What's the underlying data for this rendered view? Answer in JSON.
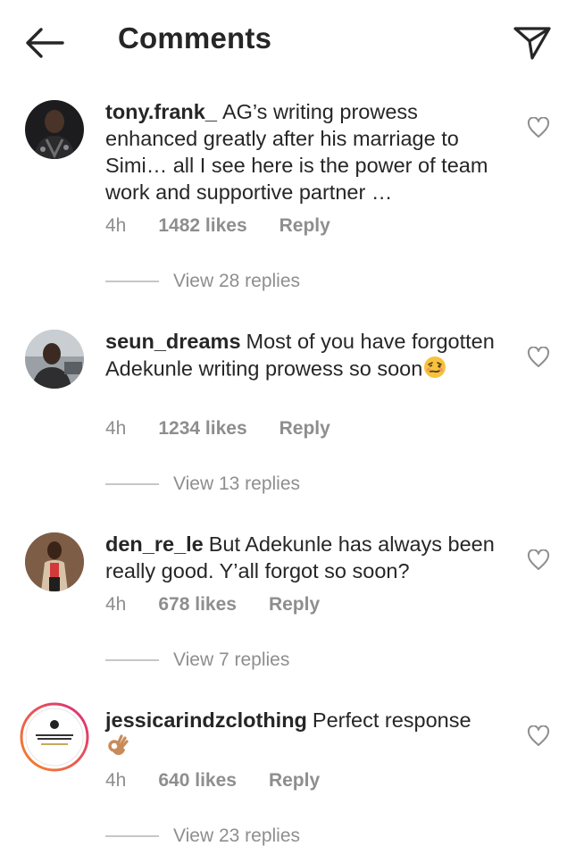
{
  "header": {
    "title": "Comments"
  },
  "comments": [
    {
      "username": "tony.frank_",
      "text": "AG’s writing prowess enhanced greatly after his marriage to Simi… all I see here is the power of team work and supportive partner …",
      "time": "4h",
      "likes": "1482 likes",
      "reply": "Reply",
      "view_replies": "View 28 replies"
    },
    {
      "username": "seun_dreams",
      "text": "Most of you have forgotten Adekunle writing prowess so soon",
      "emoji": "woozy-face",
      "time": "4h",
      "likes": "1234 likes",
      "reply": "Reply",
      "view_replies": "View 13 replies"
    },
    {
      "username": "den_re_le",
      "text": "But Adekunle has always been really good. Y’all forgot so soon?",
      "time": "4h",
      "likes": "678 likes",
      "reply": "Reply",
      "view_replies": "View 7 replies"
    },
    {
      "username": "jessicarindzclothing",
      "text": "Perfect response",
      "emoji": "ok-hand",
      "time": "4h",
      "likes": "640 likes",
      "reply": "Reply",
      "view_replies": "View 23 replies"
    }
  ],
  "icons": {
    "back": "arrow-left-icon",
    "send": "paper-plane-icon",
    "like": "heart-outline-icon"
  },
  "colors": {
    "text": "#262626",
    "secondary": "#8e8e8e",
    "story_ring_start": "#f58529",
    "story_ring_end": "#dd2a7b"
  }
}
